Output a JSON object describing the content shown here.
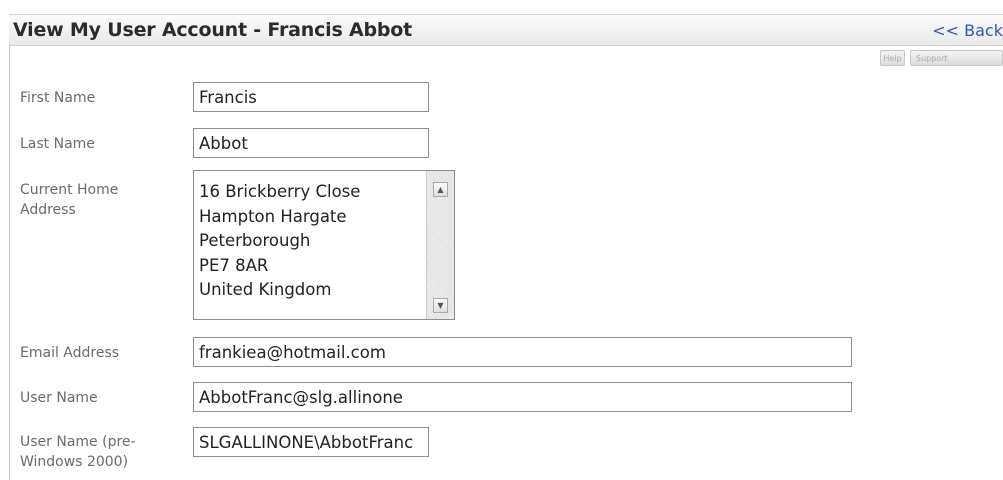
{
  "header": {
    "title": "View My User Account - Francis Abbot",
    "back_link": "<< Back"
  },
  "toolbar": {
    "help_label": "Help",
    "support_label": "Support"
  },
  "form": {
    "first_name": {
      "label": "First Name",
      "value": "Francis"
    },
    "last_name": {
      "label": "Last Name",
      "value": "Abbot"
    },
    "home_address": {
      "label": "Current Home Address",
      "lines": [
        "16 Brickberry Close",
        "Hampton Hargate",
        "Peterborough",
        "PE7 8AR",
        "United Kingdom"
      ]
    },
    "email": {
      "label": "Email Address",
      "value": "frankiea@hotmail.com"
    },
    "user_name": {
      "label": "User Name",
      "value": "AbbotFranc@slg.allinone"
    },
    "user_name_pre2000": {
      "label": "User Name (pre-Windows 2000)",
      "value": "SLGALLINONE\\AbbotFranc"
    }
  },
  "icons": {
    "scroll_up": "triangle-up",
    "scroll_down": "triangle-down"
  }
}
